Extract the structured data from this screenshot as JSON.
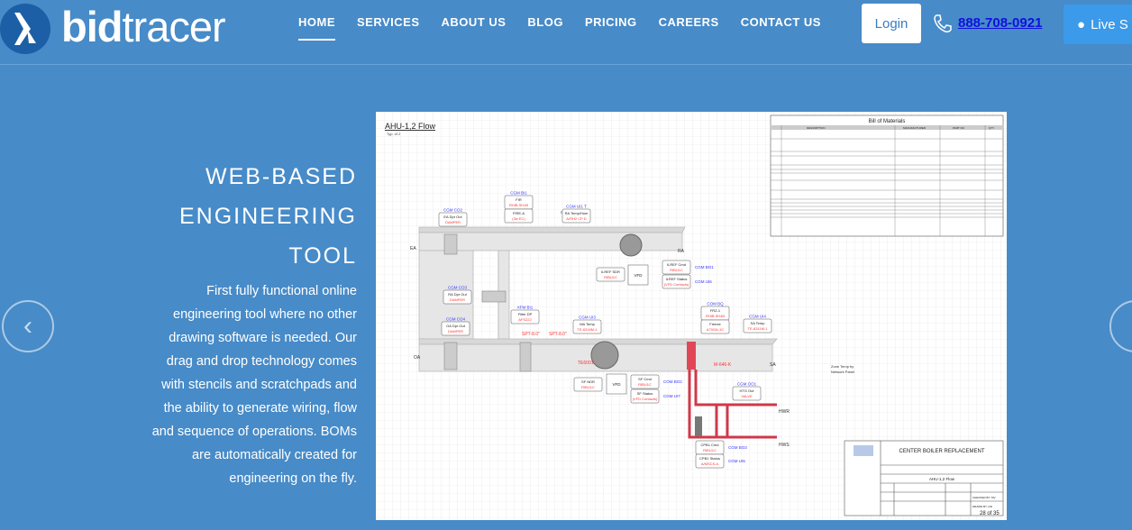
{
  "header": {
    "brand_bold": "bid",
    "brand_light": "tracer",
    "nav": [
      "HOME",
      "SERVICES",
      "ABOUT US",
      "BLOG",
      "PRICING",
      "CAREERS",
      "CONTACT US"
    ],
    "login": "Login",
    "phone": "888-708-0921",
    "chat": "Live S"
  },
  "hero": {
    "title": [
      "WEB-BASED",
      "ENGINEERING",
      "TOOL"
    ],
    "paragraph": "First fully functional online engineering tool where no other drawing software is needed. Our drag and drop technology comes with stencils and scratchpads and the ability to generate wiring, flow and sequence of operations. BOMs are automatically created for engineering on the fly.",
    "prev": "‹",
    "next": "›"
  },
  "diagram": {
    "title": "AHU-1,2 Flow",
    "subtitle": "Typ. of 2",
    "bom": {
      "title": "Bill of Materials",
      "headers": [
        "",
        "DESCRIPTION",
        "MANUFACTURER",
        "PART NO",
        "QTY"
      ]
    },
    "labels": {
      "ea": "EA",
      "ra": "RA",
      "oa": "OA",
      "sa": "SA",
      "hwr": "HWR",
      "hws": "HWS",
      "te6001": "TE6001",
      "m646": "M-646-K",
      "spt1": "SPT-8.0\"",
      "spt2": "SPT-8.0\"",
      "zone": "Zone Temp by",
      "zone2": "Network Panel"
    },
    "points": [
      {
        "tag": "CGM CO2",
        "l1": "EA Dpr Out",
        "l2": "DAMPER"
      },
      {
        "tag": "CGM BI1",
        "l1": "FIR",
        "l2": "RHIB SH1B"
      },
      {
        "tag": "",
        "l1": "FIRE-A",
        "l2": "(3w EC)"
      },
      {
        "tag": "CGM UI1 T",
        "l1": "RA Temp/Hum",
        "l2": "A/RH2 CP D"
      },
      {
        "tag": "",
        "l1": "ILREF SDR",
        "l2": "RIBU1C"
      },
      {
        "tag": "CGM BO1",
        "l1": "ILREF Cmd",
        "l2": "RIBU1C"
      },
      {
        "tag": "CGM UI6",
        "l1": "ILREF Status",
        "l2": "(VFD Contacts)"
      },
      {
        "tag": "CGM CO3",
        "l1": "RA Dpr Out",
        "l2": "DAMPER"
      },
      {
        "tag": "CGM CO4",
        "l1": "OA Dpr Out",
        "l2": "DAMPER"
      },
      {
        "tag": "XFM BI1",
        "l1": "Filter DP",
        "l2": "AFS222"
      },
      {
        "tag": "CGM UI3",
        "l1": "MA Temp",
        "l2": "TE-6316M-1"
      },
      {
        "tag": "COM BQ",
        "l1": "FRZ-1",
        "l2": "RHIB SH4B"
      },
      {
        "tag": "",
        "l1": "Freeze",
        "l2": "A70GA-1C"
      },
      {
        "tag": "CGM UI4",
        "l1": "SA Temp",
        "l2": "TE-6311M-1"
      },
      {
        "tag": "",
        "l1": "SF NDR",
        "l2": "RIBU1C"
      },
      {
        "tag": "COM BO2",
        "l1": "SF Cmd",
        "l2": "RIBU1C"
      },
      {
        "tag": "CGM UI7",
        "l1": "SF Status",
        "l2": "(VFD Contacts)"
      },
      {
        "tag": "CGM OO1",
        "l1": "HTG Out",
        "l2": "VALVE"
      },
      {
        "tag": "CGM BO3",
        "l1": "CPB1 Cmd",
        "l2": "RIBU1C"
      },
      {
        "tag": "CGM UI5",
        "l1": "CPB1 Status",
        "l2": "A/MSCS-A"
      }
    ],
    "tag2": "CGM UI2 H",
    "vfd": "VFD",
    "titleblock": {
      "project": "CENTER BOILER REPLACEMENT",
      "sheet_title": "AHU-1,2 Flow",
      "checked": "CHECKED BY: MV",
      "drawn": "DRAWN BY: DD",
      "page": "28 of 35"
    }
  },
  "colors": {
    "background": "#478bc8",
    "tag": "#3b3bff",
    "value": "#ff3333",
    "pipe": "#d0384a"
  }
}
